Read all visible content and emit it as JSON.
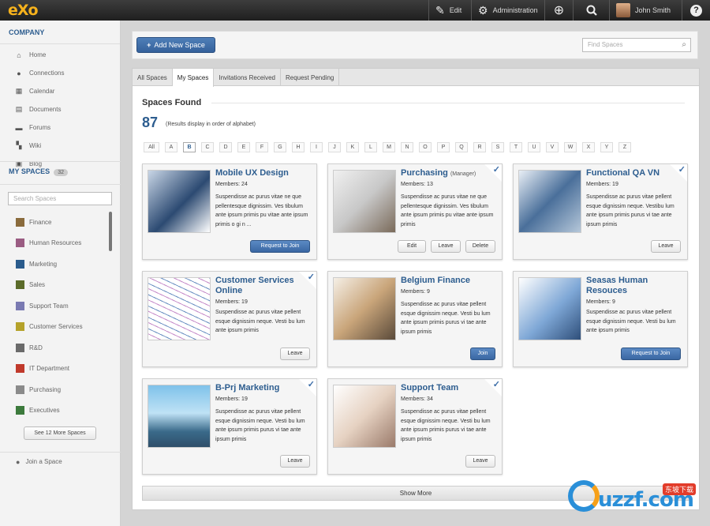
{
  "topbar": {
    "logo": "eXo",
    "edit_label": "Edit",
    "admin_label": "Administration",
    "user_name": "John Smith",
    "help": "?"
  },
  "sidebar": {
    "company_title": "COMPANY",
    "nav": [
      {
        "label": "Home",
        "icon": "home-icon"
      },
      {
        "label": "Connections",
        "icon": "person-icon"
      },
      {
        "label": "Calendar",
        "icon": "calendar-icon"
      },
      {
        "label": "Documents",
        "icon": "folder-icon"
      },
      {
        "label": "Forums",
        "icon": "forum-icon"
      },
      {
        "label": "Wiki",
        "icon": "wiki-icon"
      },
      {
        "label": "Blog",
        "icon": "blog-icon"
      }
    ],
    "myspaces_title": "MY SPACES",
    "myspaces_count": "32",
    "search_placeholder": "Search Spaces",
    "spaces": [
      {
        "label": "Finance",
        "color": "#8a6b3c"
      },
      {
        "label": "Human Resources",
        "color": "#9a5c82"
      },
      {
        "label": "Marketing",
        "color": "#2a5b8c"
      },
      {
        "label": "Sales",
        "color": "#5b6b2a"
      },
      {
        "label": "Support Team",
        "color": "#7a7ab2"
      },
      {
        "label": "Customer Services",
        "color": "#b5a22a"
      },
      {
        "label": "R&D",
        "color": "#6a6a6a"
      },
      {
        "label": "IT Department",
        "color": "#c0392b"
      },
      {
        "label": "Purchasing",
        "color": "#8a8a8a"
      },
      {
        "label": "Executives",
        "color": "#3c7a3c"
      }
    ],
    "see_more": "See 12 More Spaces",
    "join_space": "Join a Space"
  },
  "toolbar": {
    "add_label": "Add New Space",
    "find_placeholder": "Find Spaces"
  },
  "tabs": [
    "All Spaces",
    "My Spaces",
    "Invitations Received",
    "Request Pending"
  ],
  "active_tab": "My Spaces",
  "found_title": "Spaces Found",
  "found_count": "87",
  "found_note": "(Results display in order of alphabet)",
  "alphabet": [
    "All",
    "A",
    "B",
    "C",
    "D",
    "E",
    "F",
    "G",
    "H",
    "I",
    "J",
    "K",
    "L",
    "M",
    "N",
    "O",
    "P",
    "Q",
    "R",
    "S",
    "T",
    "U",
    "V",
    "W",
    "X",
    "Y",
    "Z"
  ],
  "selected_letter": "B",
  "cards": [
    {
      "title": "Mobile UX Design",
      "role": "",
      "members": "Members: 24",
      "desc": "Suspendisse ac purus vitae ne que pellentesque dignissim. Ves tibulum ante ipsum primis pu vitae ante ipsum primis o gi n ...",
      "buttons": [
        {
          "label": "Request to Join",
          "primary": true
        }
      ],
      "checked": false
    },
    {
      "title": "Purchasing",
      "role": "(Manager)",
      "members": "Members: 13",
      "desc": "Suspendisse ac purus vitae ne que pellentesque dignissim. Ves tibulum ante ipsum primis pu vitae ante ipsum primis",
      "buttons": [
        {
          "label": "Edit",
          "primary": false
        },
        {
          "label": "Leave",
          "primary": false
        },
        {
          "label": "Delete",
          "primary": false
        }
      ],
      "checked": true
    },
    {
      "title": "Functional QA VN",
      "role": "",
      "members": "Members: 19",
      "desc": "Suspendisse ac purus vitae pellent esque dignissim neque. Vestibu lum ante ipsum primis purus vi tae ante ipsum primis",
      "buttons": [
        {
          "label": "Leave",
          "primary": false
        }
      ],
      "checked": true
    },
    {
      "title": "Customer Services Online",
      "role": "",
      "members": "Members: 19",
      "desc": "Suspendisse ac purus vitae pellent esque dignissim neque. Vesti bu lum ante ipsum primis",
      "buttons": [
        {
          "label": "Leave",
          "primary": false
        }
      ],
      "checked": true
    },
    {
      "title": "Belgium Finance",
      "role": "",
      "members": "Members: 9",
      "desc": "Suspendisse ac purus vitae pellent esque dignissim neque. Vesti bu lum ante ipsum primis purus vi tae ante ipsum primis",
      "buttons": [
        {
          "label": "Join",
          "primary": true
        }
      ],
      "checked": false
    },
    {
      "title": "Seasas Human Resouces",
      "role": "",
      "members": "Members: 9",
      "desc": "Suspendisse ac purus vitae pellent esque dignissim neque. Vesti bu lum ante ipsum primis",
      "buttons": [
        {
          "label": "Request to Join",
          "primary": true
        }
      ],
      "checked": false
    },
    {
      "title": "B-Prj  Marketing",
      "role": "",
      "members": "Members: 19",
      "desc": "Suspendisse ac purus vitae pellent esque dignissim neque. Vesti bu lum ante ipsum primis purus vi tae ante ipsum primis",
      "buttons": [
        {
          "label": "Leave",
          "primary": false
        }
      ],
      "checked": true
    },
    {
      "title": "Support Team",
      "role": "",
      "members": "Members: 34",
      "desc": "Suspendisse ac purus vitae pellent esque dignissim neque. Vesti bu lum ante ipsum primis purus vi tae ante ipsum primis",
      "buttons": [
        {
          "label": "Leave",
          "primary": false
        }
      ],
      "checked": true
    }
  ],
  "show_more": "Show More",
  "watermark": {
    "text": "uzzf.com",
    "badge": "东坡下载"
  }
}
